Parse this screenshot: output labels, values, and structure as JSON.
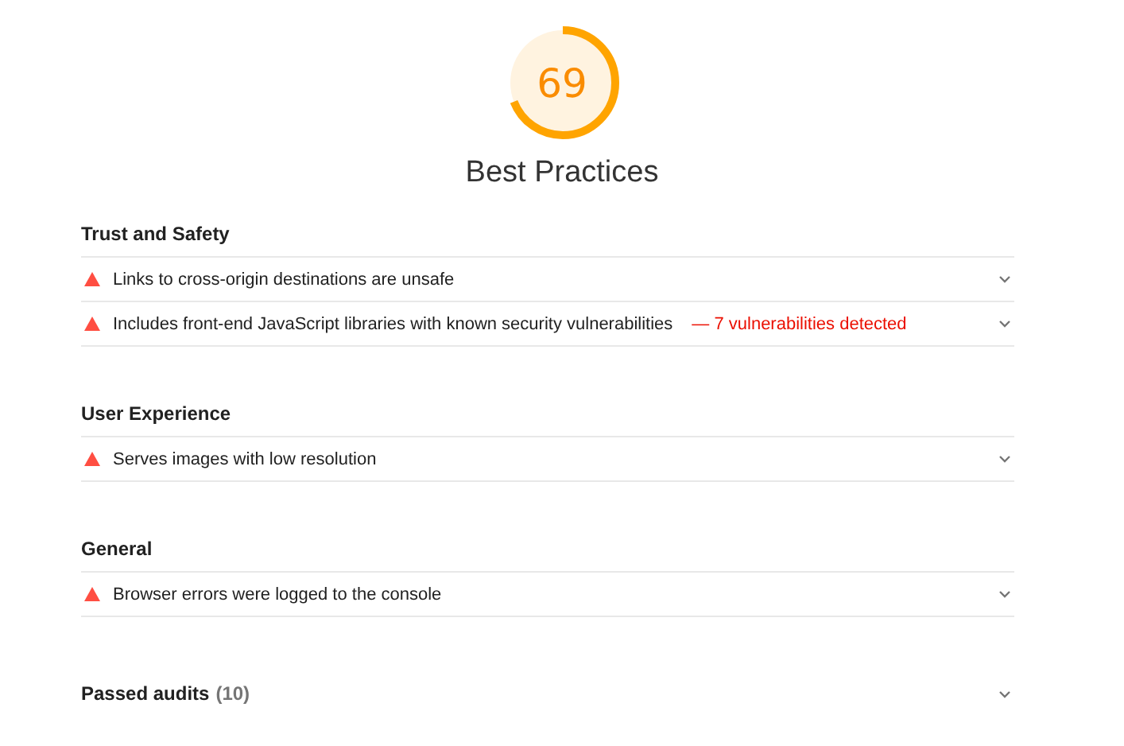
{
  "gauge": {
    "score": "69",
    "level": 0.69,
    "title": "Best Practices"
  },
  "groups": [
    {
      "title": "Trust and Safety",
      "audits": [
        {
          "kind": "fail",
          "title": "Links to cross-origin destinations are unsafe",
          "expanded": false
        },
        {
          "kind": "fail",
          "title": "Includes front-end JavaScript libraries with known security vulnerabilities",
          "display_value": "— 7 vulnerabilities detected",
          "expanded": false
        }
      ]
    },
    {
      "title": "User Experience",
      "audits": [
        {
          "kind": "fail",
          "title": "Serves images with low resolution",
          "expanded": false
        }
      ]
    },
    {
      "title": "General",
      "audits": [
        {
          "kind": "fail",
          "title": "Browser errors were logged to the console",
          "expanded": false
        }
      ]
    }
  ],
  "passed": {
    "label": "Passed audits",
    "count": "(10)",
    "expanded": false
  }
}
